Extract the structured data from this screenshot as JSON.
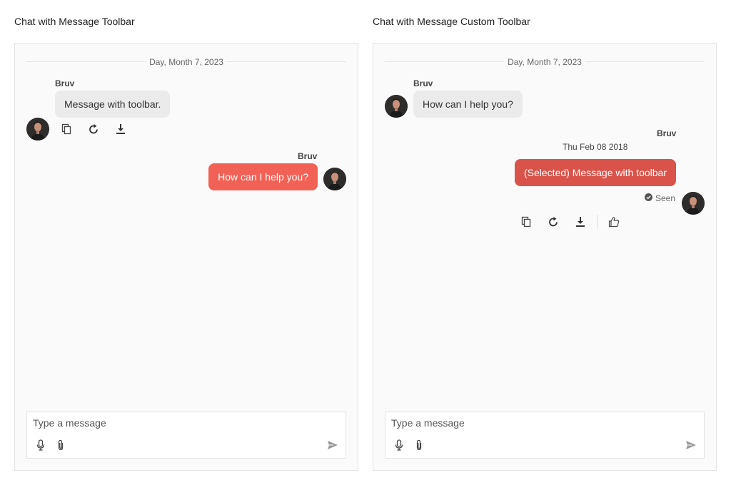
{
  "demos": [
    {
      "title": "Chat with Message Toolbar",
      "date_separator": "Day, Month 7, 2023",
      "incoming": {
        "sender": "Bruv",
        "text": "Message with toolbar."
      },
      "outgoing": {
        "sender": "Bruv",
        "text": "How can I help you?"
      },
      "toolbar": [
        "copy-icon",
        "refresh-icon",
        "download-icon"
      ],
      "composer": {
        "placeholder": "Type a message",
        "icons": [
          "microphone-icon",
          "paperclip-icon",
          "send-icon"
        ]
      }
    },
    {
      "title": "Chat with Message Custom Toolbar",
      "date_separator": "Day, Month 7, 2023",
      "incoming": {
        "sender": "Bruv",
        "text": "How can I help you?"
      },
      "outgoing": {
        "sender": "Bruv",
        "timestamp": "Thu Feb 08 2018",
        "text": "(Selected) Message with toolbar",
        "status": "Seen"
      },
      "toolbar": [
        "copy-icon",
        "refresh-icon",
        "download-icon",
        "thumbs-up-icon"
      ],
      "composer": {
        "placeholder": "Type a message",
        "icons": [
          "microphone-icon",
          "paperclip-icon",
          "send-icon"
        ]
      }
    }
  ],
  "colors": {
    "outgoing_bubble": "#f26156",
    "selected_bubble": "#d9534a",
    "incoming_bubble": "#ebebeb",
    "panel_background": "#fafafa"
  }
}
